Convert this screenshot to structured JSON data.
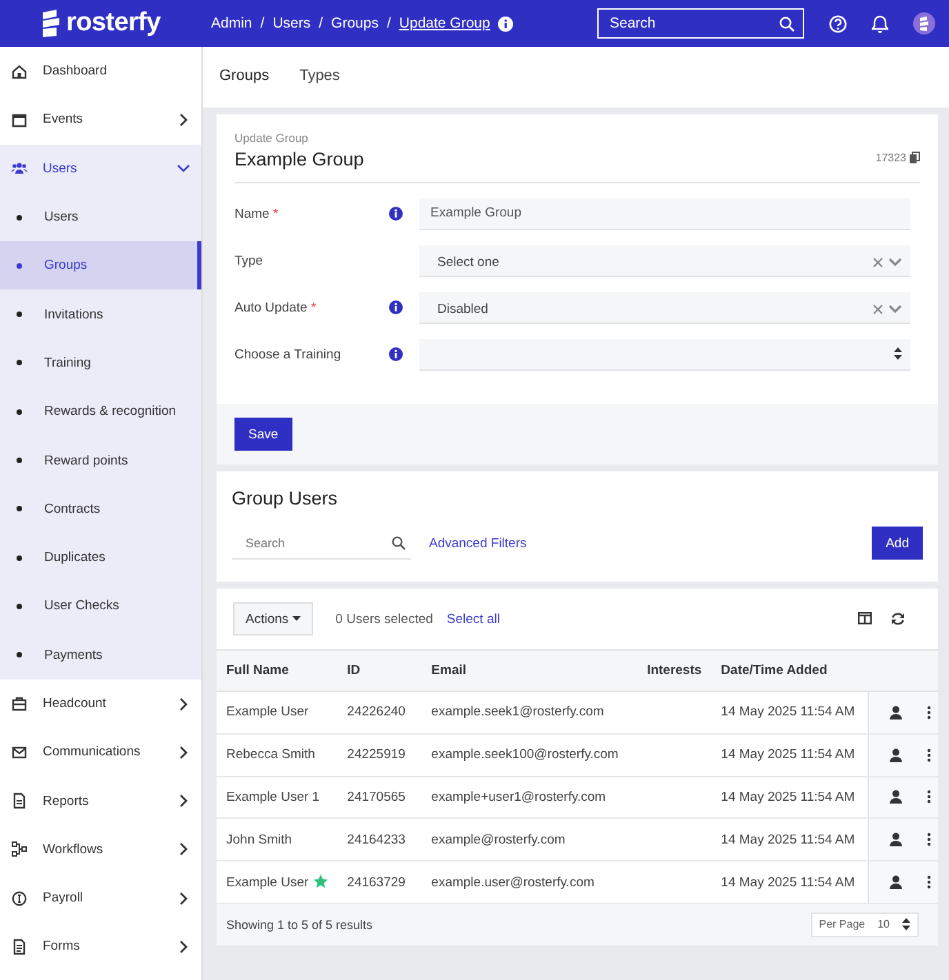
{
  "header": {
    "logo": "rosterfy",
    "breadcrumbs": [
      {
        "label": "Admin",
        "current": false
      },
      {
        "separator": "/"
      },
      {
        "label": "Users",
        "current": false
      },
      {
        "separator": "/"
      },
      {
        "label": "Groups",
        "current": false
      },
      {
        "separator": "/"
      },
      {
        "label": "Update Group",
        "current": true
      }
    ],
    "search": {
      "placeholder": "Search"
    }
  },
  "sidebar": {
    "items": [
      {
        "label": "Dashboard",
        "selected": false
      },
      {
        "label": "Events",
        "selected": false,
        "expanded": false
      },
      {
        "label": "Users",
        "selected": true,
        "expanded": true,
        "children": [
          {
            "label": "Users",
            "selected": false
          },
          {
            "label": "Groups",
            "selected": true
          },
          {
            "label": "Invitations",
            "selected": false
          },
          {
            "label": "Training",
            "selected": false
          },
          {
            "label": "Rewards & recognition",
            "selected": false
          },
          {
            "label": "Reward points",
            "selected": false
          },
          {
            "label": "Contracts",
            "selected": false
          },
          {
            "label": "Duplicates",
            "selected": false
          },
          {
            "label": "User Checks",
            "selected": false
          },
          {
            "label": "Payments",
            "selected": false
          }
        ]
      },
      {
        "label": "Headcount",
        "selected": false,
        "expanded": false
      },
      {
        "label": "Communications",
        "selected": false,
        "expanded": false
      },
      {
        "label": "Reports",
        "selected": false,
        "expanded": false
      },
      {
        "label": "Workflows",
        "selected": false,
        "expanded": false
      },
      {
        "label": "Payroll",
        "selected": false,
        "expanded": false
      },
      {
        "label": "Forms",
        "selected": false,
        "expanded": false
      }
    ]
  },
  "tabs": [
    {
      "label": "Groups",
      "selected": true
    },
    {
      "label": "Types",
      "selected": false
    }
  ],
  "form": {
    "subtitle": "Update Group",
    "title": "Example Group",
    "id": "17323",
    "required_mark": "*",
    "fields": [
      {
        "label": "Name",
        "required": true,
        "info": true,
        "kind": "text",
        "value": "Example Group"
      },
      {
        "label": "Type",
        "required": false,
        "info": false,
        "kind": "select",
        "value": "Select one"
      },
      {
        "label": "Auto Update",
        "required": true,
        "info": true,
        "kind": "select",
        "value": "Disabled"
      },
      {
        "label": "Choose a Training",
        "required": false,
        "info": true,
        "kind": "native-select"
      }
    ],
    "save_button": "Save"
  },
  "group_users": {
    "title": "Group Users",
    "search": {
      "placeholder": "Search"
    },
    "advanced_filters": "Advanced Filters",
    "add_button": "Add"
  },
  "table": {
    "actions_button": "Actions",
    "selected_count": "0 Users selected",
    "select_all": "Select all",
    "columns": [
      "Full Name",
      "ID",
      "Email",
      "Interests",
      "Date/Time Added"
    ],
    "rows": [
      {
        "cells": [
          "Example User",
          "24226240",
          "example.seek1@rosterfy.com",
          "",
          "14 May 2025 11:54 AM"
        ],
        "starred": false
      },
      {
        "cells": [
          "Rebecca Smith",
          "24225919",
          "example.seek100@rosterfy.com",
          "",
          "14 May 2025 11:54 AM"
        ],
        "starred": false
      },
      {
        "cells": [
          "Example User 1",
          "24170565",
          "example+user1@rosterfy.com",
          "",
          "14 May 2025 11:54 AM"
        ],
        "starred": false
      },
      {
        "cells": [
          "John Smith",
          "24164233",
          "example@rosterfy.com",
          "",
          "14 May 2025 11:54 AM"
        ],
        "starred": false
      },
      {
        "cells": [
          "Example User",
          "24163729",
          "example.user@rosterfy.com",
          "",
          "14 May 2025 11:54 AM"
        ],
        "starred": true
      }
    ],
    "summary": "Showing 1 to 5 of 5 results",
    "per_page_label": "Per Page",
    "per_page": "10"
  }
}
